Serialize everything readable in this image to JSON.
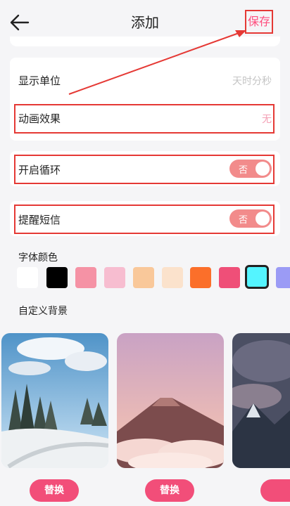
{
  "header": {
    "title": "添加",
    "save_label": "保存"
  },
  "settings": {
    "display_unit": {
      "label": "显示单位",
      "value": "天时分秒"
    },
    "animation": {
      "label": "动画效果",
      "value": "无"
    },
    "loop": {
      "label": "开启循环",
      "toggle_text": "否"
    },
    "sms": {
      "label": "提醒短信",
      "toggle_text": "否"
    }
  },
  "font_color": {
    "title": "字体颜色",
    "swatches": [
      "#ffffff",
      "#000000",
      "#f592a5",
      "#f7bdd0",
      "#f9c89a",
      "#fbe2cc",
      "#fb6f2a",
      "#ef4f78",
      "#54f4ff",
      "#9b9bf5"
    ],
    "selected_index": 8
  },
  "custom_bg": {
    "title": "自定义背景",
    "replace_label": "替换"
  },
  "colors": {
    "accent": "#f24e79",
    "toggle_off": "#f28b8b",
    "highlight": "#e53935"
  }
}
